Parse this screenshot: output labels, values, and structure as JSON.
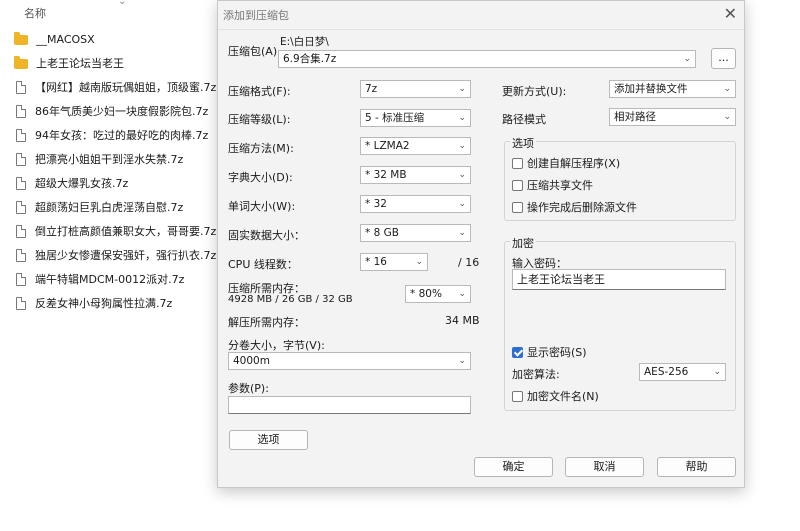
{
  "explorer": {
    "column_header": "名称",
    "items": [
      {
        "name": "__MACOSX",
        "type": "folder"
      },
      {
        "name": "上老王论坛当老王",
        "type": "folder"
      },
      {
        "name": "【网红】越南版玩偶姐姐，顶级蜜.7z",
        "type": "file"
      },
      {
        "name": "86年气质美少妇一块度假影院包.7z",
        "type": "file"
      },
      {
        "name": "94年女孩：吃过的最好吃的肉棒.7z",
        "type": "file"
      },
      {
        "name": "把漂亮小姐姐干到淫水失禁.7z",
        "type": "file"
      },
      {
        "name": "超级大爆乳女孩.7z",
        "type": "file"
      },
      {
        "name": "超颜荡妇巨乳白虎淫荡自慰.7z",
        "type": "file"
      },
      {
        "name": "倒立打桩高颜值兼职女大，哥哥要.7z",
        "type": "file"
      },
      {
        "name": "独居少女惨遭保安强奸，强行扒衣.7z",
        "type": "file"
      },
      {
        "name": "端午特辑MDCM-0012派对.7z",
        "type": "file"
      },
      {
        "name": "反差女神小母狗属性拉满.7z",
        "type": "file"
      }
    ]
  },
  "dialog": {
    "title": "添加到压缩包",
    "archive_label": "压缩包(A)",
    "archive_path": "E:\\白日梦\\",
    "archive_name": "6.9合集.7z",
    "browse_label": "...",
    "format_label": "压缩格式(F):",
    "format_value": "7z",
    "level_label": "压缩等级(L):",
    "level_value": "5 - 标准压缩",
    "method_label": "压缩方法(M):",
    "method_value": "* LZMA2",
    "dict_label": "字典大小(D):",
    "dict_value": "* 32 MB",
    "word_label": "单词大小(W):",
    "word_value": "* 32",
    "solid_label": "固实数据大小：",
    "solid_value": "* 8 GB",
    "threads_label": "CPU 线程数：",
    "threads_value": "* 16",
    "threads_max": "/ 16",
    "mem_comp_label": "压缩所需内存：",
    "mem_comp_value": "4928 MB / 26 GB / 32 GB",
    "mem_percent": "* 80%",
    "mem_decomp_label": "解压所需内存：",
    "mem_decomp_value": "34 MB",
    "split_label": "分卷大小，字节(V):",
    "split_value": "4000m",
    "params_label": "参数(P):",
    "params_value": "",
    "options_button": "选项",
    "update_label": "更新方式(U):",
    "update_value": "添加并替换文件",
    "path_label": "路径模式",
    "path_value": "相对路径",
    "options_group": {
      "title": "选项",
      "sfx": "创建自解压程序(X)",
      "shared": "压缩共享文件",
      "delete": "操作完成后删除源文件"
    },
    "encrypt_group": {
      "title": "加密",
      "password_label": "输入密码：",
      "password_value": "上老王论坛当老王",
      "show_password": "显示密码(S)",
      "method_label": "加密算法:",
      "method_value": "AES-256",
      "encrypt_names": "加密文件名(N)"
    },
    "ok": "确定",
    "cancel": "取消",
    "help": "帮助"
  }
}
